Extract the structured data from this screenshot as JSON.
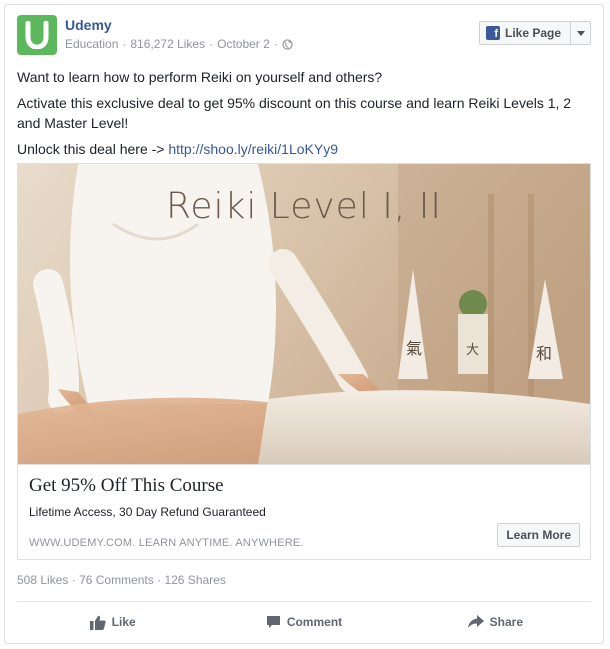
{
  "post": {
    "page_name": "Udemy",
    "category": "Education",
    "likes": "816,272 Likes",
    "date": "October 2",
    "like_page_label": "Like Page",
    "text_lines": [
      "Want to learn how to perform Reiki on yourself and others?",
      "Activate this exclusive deal to get 95% discount on this course and learn Reiki Levels 1, 2 and Master Level!"
    ],
    "unlock_prefix": "Unlock this deal here -> ",
    "unlock_link": "http://shoo.ly/reiki/1LoKYy9"
  },
  "attachment": {
    "image_title": "Reiki Level I, II",
    "title": "Get 95% Off This Course",
    "description": "Lifetime Access, 30 Day Refund Guaranteed",
    "domain": "WWW.UDEMY.COM. LEARN ANYTIME. ANYWHERE.",
    "cta": "Learn More"
  },
  "stats": {
    "likes": "508 Likes",
    "comments": "76 Comments",
    "shares": "126 Shares"
  },
  "actions": {
    "like": "Like",
    "comment": "Comment",
    "share": "Share"
  },
  "colors": {
    "brand_green": "#5cb85c",
    "link_blue": "#365899",
    "facebook_blue": "#3b5998"
  }
}
